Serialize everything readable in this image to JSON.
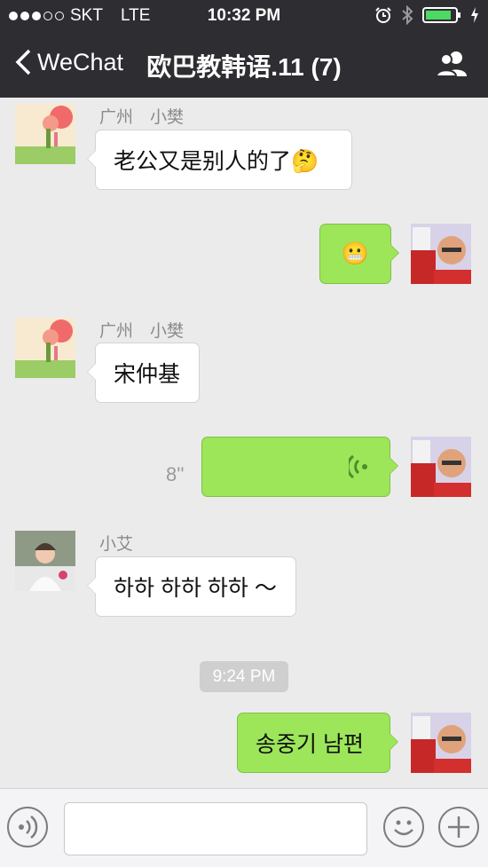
{
  "status": {
    "carrier": "SKT",
    "network": "LTE",
    "time": "10:32 PM"
  },
  "nav": {
    "back_label": "WeChat",
    "title": "欧巴教韩语.11 (7)"
  },
  "messages": [
    {
      "sender": "广州　小樊",
      "text": "老公又是别人的了🤔"
    },
    {
      "text": "😬"
    },
    {
      "sender": "广州　小樊",
      "text": "宋仲基"
    },
    {
      "duration": "8''"
    },
    {
      "sender": "小艾",
      "text": "하하 하하 하하 ～"
    },
    {
      "timestamp": "9:24 PM"
    },
    {
      "text": "송중기 남편"
    }
  ],
  "input": {
    "placeholder": ""
  },
  "colors": {
    "bar": "#2e2d32",
    "outgoing": "#9de65a",
    "incoming": "#ffffff",
    "background": "#ebebeb"
  }
}
